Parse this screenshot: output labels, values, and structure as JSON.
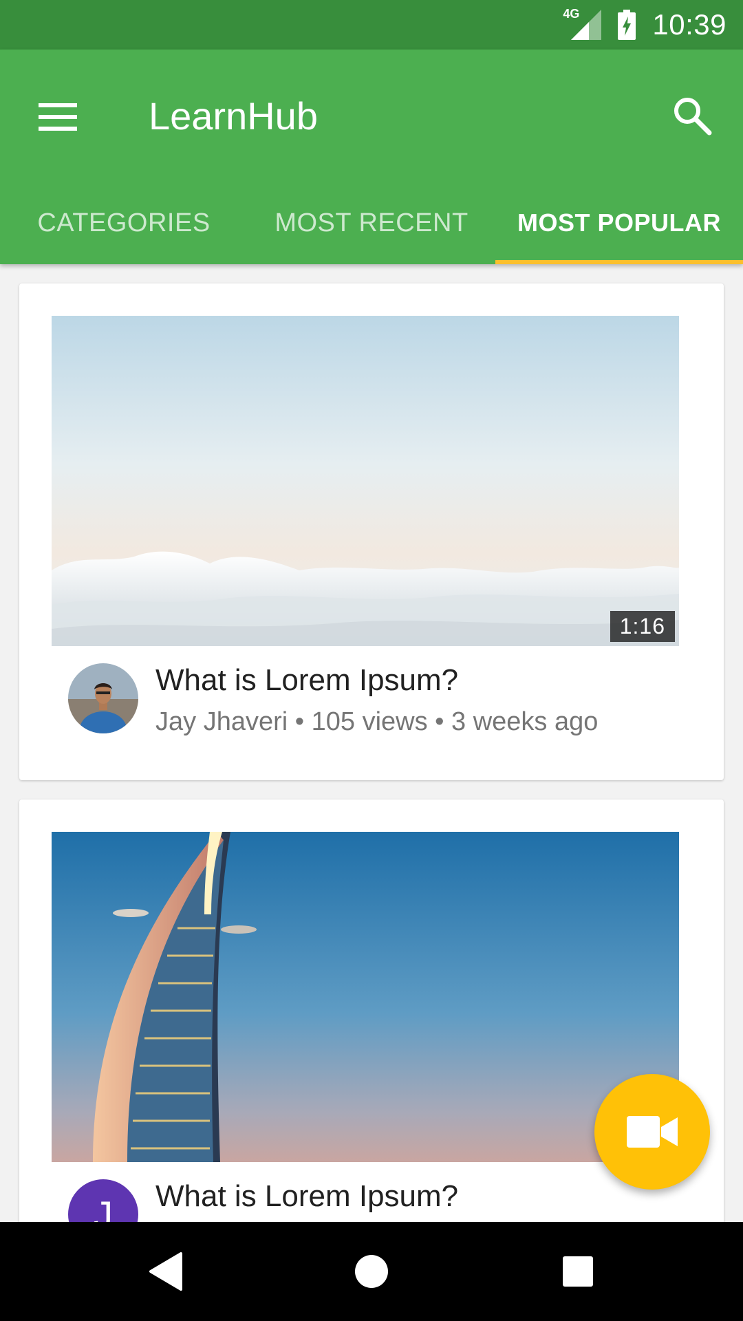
{
  "status_bar": {
    "network_label": "4G",
    "time": "10:39"
  },
  "app_bar": {
    "title": "LearnHub",
    "menu_icon": "hamburger-menu-icon",
    "search_icon": "search-icon",
    "background_color": "#4caf50"
  },
  "tabs": [
    {
      "label": "CATEGORIES",
      "active": false
    },
    {
      "label": "MOST RECENT",
      "active": false
    },
    {
      "label": "MOST POPULAR",
      "active": true
    }
  ],
  "tab_indicator_color": "#fbc02d",
  "videos": [
    {
      "title": "What is Lorem Ipsum?",
      "meta": "Jay Jhaveri • 105 views • 3 weeks ago",
      "duration": "1:16",
      "thumbnail": "sky-above-clouds"
    },
    {
      "title": "What is Lorem Ipsum?",
      "avatar_letter": "J",
      "thumbnail": "burj-al-arab-tower"
    }
  ],
  "fab": {
    "icon": "video-camera-icon",
    "color": "#ffc107"
  },
  "nav_bar": {
    "back_icon": "back-triangle-icon",
    "home_icon": "home-circle-icon",
    "recents_icon": "recents-square-icon"
  }
}
